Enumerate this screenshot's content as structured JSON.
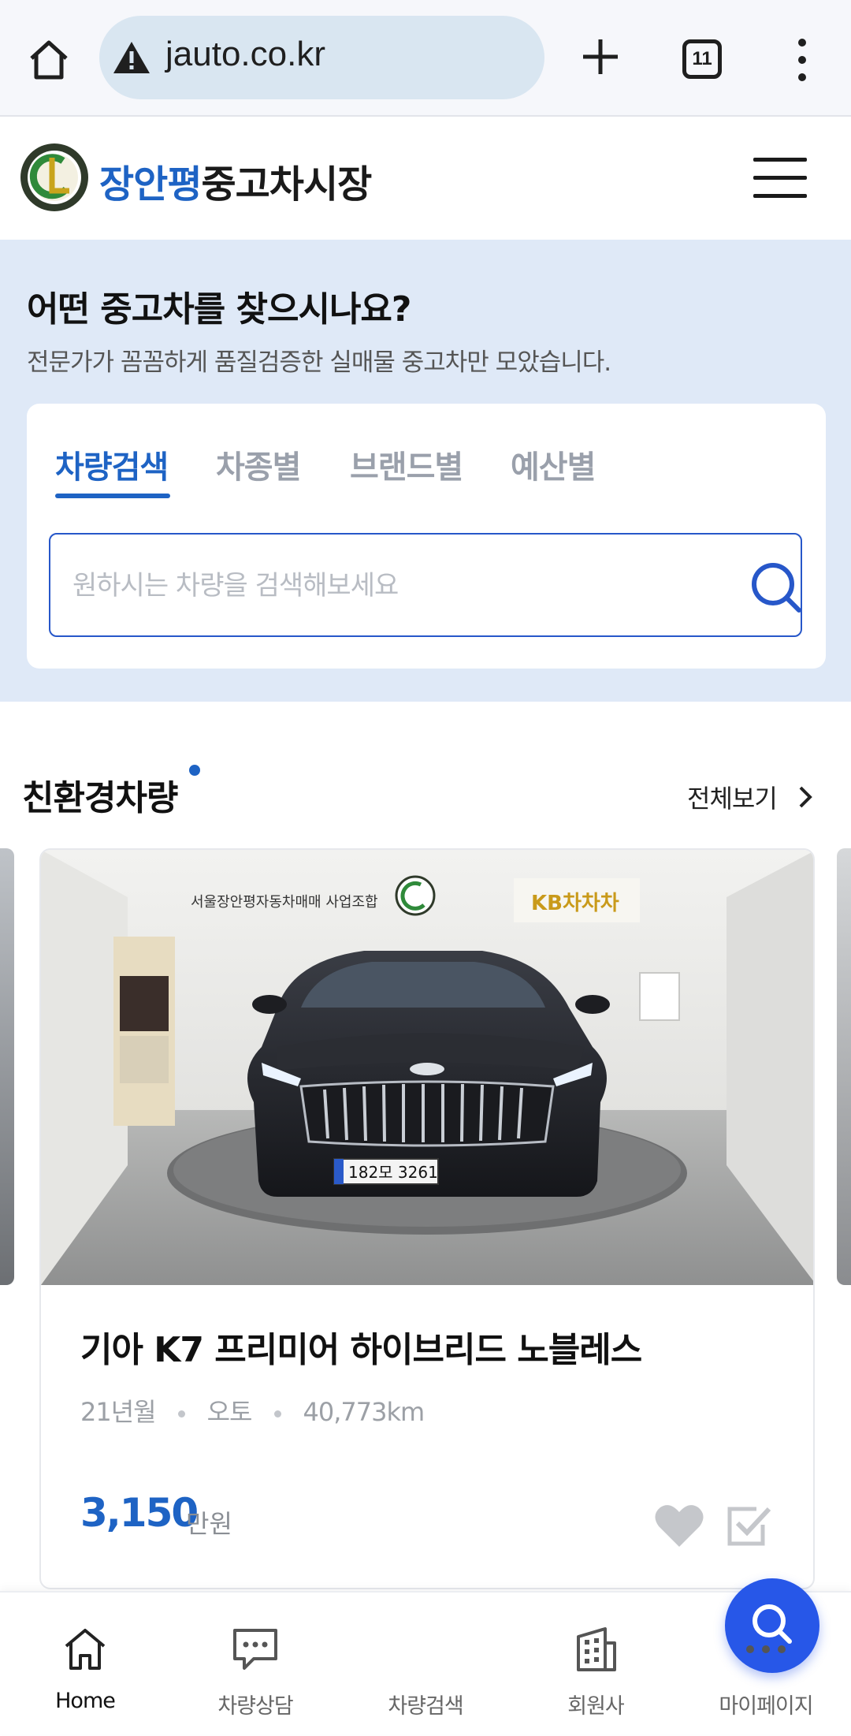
{
  "browser": {
    "url": "jauto.co.kr",
    "tab_count": "11"
  },
  "header": {
    "logo_blue": "장안평",
    "logo_dark": "중고차시장"
  },
  "search": {
    "title": "어떤 중고차를 찾으시나요?",
    "subtitle": "전문가가 꼼꼼하게 품질검증한 실매물 중고차만 모았습니다.",
    "tabs": [
      {
        "label": "차량검색",
        "active": true
      },
      {
        "label": "차종별",
        "active": false
      },
      {
        "label": "브랜드별",
        "active": false
      },
      {
        "label": "예산별",
        "active": false
      }
    ],
    "placeholder": "원하시는 차량을 검색해보세요"
  },
  "section": {
    "title": "친환경차량",
    "view_all": "전체보기"
  },
  "car": {
    "name": "기아 K7 프리미어 하이브리드 노블레스",
    "year": "21년월",
    "transmission": "오토",
    "mileage": "40,773km",
    "price": "3,150",
    "price_unit": "만원",
    "photo_banner": "서울장안평자동차매매 사업조합",
    "photo_kb": "KB차차차",
    "plate": "182모 3261"
  },
  "bottom_nav": [
    {
      "label": "Home",
      "icon": "home-icon",
      "active": true
    },
    {
      "label": "차량상담",
      "icon": "chat-icon",
      "active": false
    },
    {
      "label": "차량검색",
      "icon": "search-icon",
      "active": false
    },
    {
      "label": "회원사",
      "icon": "building-icon",
      "active": false
    },
    {
      "label": "마이페이지",
      "icon": "more-icon",
      "active": false
    }
  ],
  "colors": {
    "brand_blue": "#1e63c4",
    "search_bg": "#dfe9f7",
    "fab_blue": "#2757e8"
  }
}
